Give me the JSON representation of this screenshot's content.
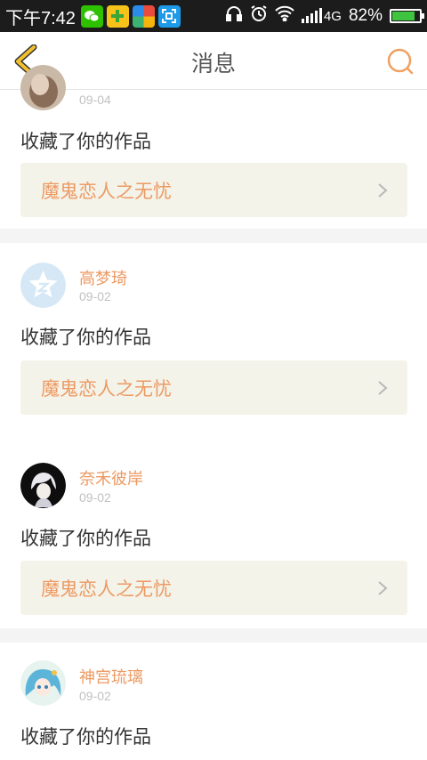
{
  "status_bar": {
    "time": "下午7:42",
    "network": "4G",
    "battery": "82%",
    "battery_level": 0.82
  },
  "header": {
    "title": "消息"
  },
  "colors": {
    "accent": "#ec9a63",
    "back_arrow": "#f2bf2f",
    "card_bg": "#f4f3e9"
  },
  "messages": [
    {
      "name": "",
      "date": "09-04",
      "action": "收藏了你的作品",
      "work": "魔鬼恋人之无忧",
      "avatar": "avatar-photo-icon"
    },
    {
      "name": "高梦琦",
      "date": "09-02",
      "action": "收藏了你的作品",
      "work": "魔鬼恋人之无忧",
      "avatar": "default-star-avatar-icon"
    },
    {
      "name": "奈禾彼岸",
      "date": "09-02",
      "action": "收藏了你的作品",
      "work": "魔鬼恋人之无忧",
      "avatar": "anime-avatar-dark-icon"
    },
    {
      "name": "神宫琉璃",
      "date": "09-02",
      "action": "收藏了你的作品",
      "work": "",
      "avatar": "anime-avatar-blue-icon"
    }
  ]
}
